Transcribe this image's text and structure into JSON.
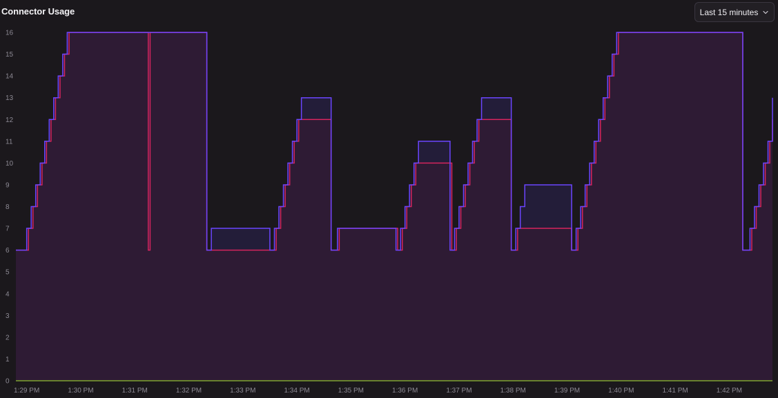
{
  "header": {
    "title": "Connector Usage",
    "time_range": "Last 15 minutes",
    "time_range_icon": "chevron-down-icon"
  },
  "colors": {
    "background": "#1b181c",
    "blue_line": "#6b45ff",
    "red_line": "#d6245e",
    "area_fill": "#2e1b34",
    "blue_excess_fill": "#231d39",
    "green_line": "#7fa62e",
    "tick_text": "#8d8a94"
  },
  "chart_data": {
    "type": "area",
    "title": "Connector Usage",
    "xlabel": "",
    "ylabel": "",
    "x_ticks": [
      "1:29 PM",
      "1:30 PM",
      "1:31 PM",
      "1:32 PM",
      "1:33 PM",
      "1:34 PM",
      "1:35 PM",
      "1:36 PM",
      "1:37 PM",
      "1:38 PM",
      "1:39 PM",
      "1:40 PM",
      "1:41 PM",
      "1:42 PM"
    ],
    "x_range": [
      "1:28:48 PM",
      "1:42:48 PM"
    ],
    "y_ticks": [
      0,
      1,
      2,
      3,
      4,
      5,
      6,
      7,
      8,
      9,
      10,
      11,
      12,
      13,
      14,
      15,
      16
    ],
    "ylim": [
      0,
      16
    ],
    "grid": false,
    "legend": "none",
    "step": true,
    "series": [
      {
        "color": "#6b45ff",
        "points": [
          [
            "1:28:48",
            6
          ],
          [
            "1:29:00",
            7
          ],
          [
            "1:29:05",
            8
          ],
          [
            "1:29:10",
            9
          ],
          [
            "1:29:15",
            10
          ],
          [
            "1:29:20",
            11
          ],
          [
            "1:29:25",
            12
          ],
          [
            "1:29:30",
            13
          ],
          [
            "1:29:35",
            14
          ],
          [
            "1:29:40",
            15
          ],
          [
            "1:29:45",
            16
          ],
          [
            "1:32:20",
            6
          ],
          [
            "1:32:25",
            7
          ],
          [
            "1:33:30",
            6
          ],
          [
            "1:33:35",
            7
          ],
          [
            "1:33:40",
            8
          ],
          [
            "1:33:45",
            9
          ],
          [
            "1:33:50",
            10
          ],
          [
            "1:33:55",
            11
          ],
          [
            "1:34:00",
            12
          ],
          [
            "1:34:05",
            13
          ],
          [
            "1:34:38",
            6
          ],
          [
            "1:34:45",
            7
          ],
          [
            "1:35:50",
            6
          ],
          [
            "1:35:55",
            7
          ],
          [
            "1:36:00",
            8
          ],
          [
            "1:36:05",
            9
          ],
          [
            "1:36:10",
            10
          ],
          [
            "1:36:15",
            11
          ],
          [
            "1:36:50",
            6
          ],
          [
            "1:36:55",
            7
          ],
          [
            "1:37:00",
            8
          ],
          [
            "1:37:05",
            9
          ],
          [
            "1:37:10",
            10
          ],
          [
            "1:37:15",
            11
          ],
          [
            "1:37:20",
            12
          ],
          [
            "1:37:25",
            13
          ],
          [
            "1:37:58",
            6
          ],
          [
            "1:38:03",
            7
          ],
          [
            "1:38:08",
            8
          ],
          [
            "1:38:13",
            9
          ],
          [
            "1:39:05",
            6
          ],
          [
            "1:39:10",
            7
          ],
          [
            "1:39:15",
            8
          ],
          [
            "1:39:20",
            9
          ],
          [
            "1:39:25",
            10
          ],
          [
            "1:39:30",
            11
          ],
          [
            "1:39:35",
            12
          ],
          [
            "1:39:40",
            13
          ],
          [
            "1:39:45",
            14
          ],
          [
            "1:39:50",
            15
          ],
          [
            "1:39:55",
            16
          ],
          [
            "1:42:15",
            6
          ],
          [
            "1:42:23",
            7
          ],
          [
            "1:42:28",
            8
          ],
          [
            "1:42:33",
            9
          ],
          [
            "1:42:38",
            10
          ],
          [
            "1:42:43",
            11
          ],
          [
            "1:42:48",
            12
          ],
          [
            "1:42:48",
            13
          ]
        ]
      },
      {
        "color": "#d6245e",
        "points": [
          [
            "1:28:48",
            6
          ],
          [
            "1:29:02",
            7
          ],
          [
            "1:29:07",
            8
          ],
          [
            "1:29:12",
            9
          ],
          [
            "1:29:17",
            10
          ],
          [
            "1:29:22",
            11
          ],
          [
            "1:29:27",
            12
          ],
          [
            "1:29:32",
            13
          ],
          [
            "1:29:37",
            14
          ],
          [
            "1:29:42",
            15
          ],
          [
            "1:29:47",
            16
          ],
          [
            "1:31:15",
            6
          ],
          [
            "1:31:17",
            16
          ],
          [
            "1:32:20",
            6
          ],
          [
            "1:33:37",
            7
          ],
          [
            "1:33:42",
            8
          ],
          [
            "1:33:47",
            9
          ],
          [
            "1:33:52",
            10
          ],
          [
            "1:33:57",
            11
          ],
          [
            "1:34:02",
            12
          ],
          [
            "1:34:38",
            6
          ],
          [
            "1:34:47",
            7
          ],
          [
            "1:35:52",
            6
          ],
          [
            "1:35:57",
            7
          ],
          [
            "1:36:02",
            8
          ],
          [
            "1:36:07",
            9
          ],
          [
            "1:36:12",
            10
          ],
          [
            "1:36:52",
            6
          ],
          [
            "1:36:57",
            7
          ],
          [
            "1:37:02",
            8
          ],
          [
            "1:37:07",
            9
          ],
          [
            "1:37:12",
            10
          ],
          [
            "1:37:17",
            11
          ],
          [
            "1:37:22",
            12
          ],
          [
            "1:37:58",
            6
          ],
          [
            "1:38:05",
            7
          ],
          [
            "1:39:05",
            6
          ],
          [
            "1:39:12",
            7
          ],
          [
            "1:39:17",
            8
          ],
          [
            "1:39:22",
            9
          ],
          [
            "1:39:27",
            10
          ],
          [
            "1:39:32",
            11
          ],
          [
            "1:39:37",
            12
          ],
          [
            "1:39:42",
            13
          ],
          [
            "1:39:47",
            14
          ],
          [
            "1:39:52",
            15
          ],
          [
            "1:39:57",
            16
          ],
          [
            "1:42:15",
            6
          ],
          [
            "1:42:25",
            7
          ],
          [
            "1:42:30",
            8
          ],
          [
            "1:42:35",
            9
          ],
          [
            "1:42:40",
            10
          ],
          [
            "1:42:45",
            11
          ],
          [
            "1:42:48",
            12
          ]
        ]
      },
      {
        "color": "#7fa62e",
        "points": [
          [
            "1:28:48",
            0
          ],
          [
            "1:42:48",
            0
          ]
        ]
      }
    ]
  }
}
